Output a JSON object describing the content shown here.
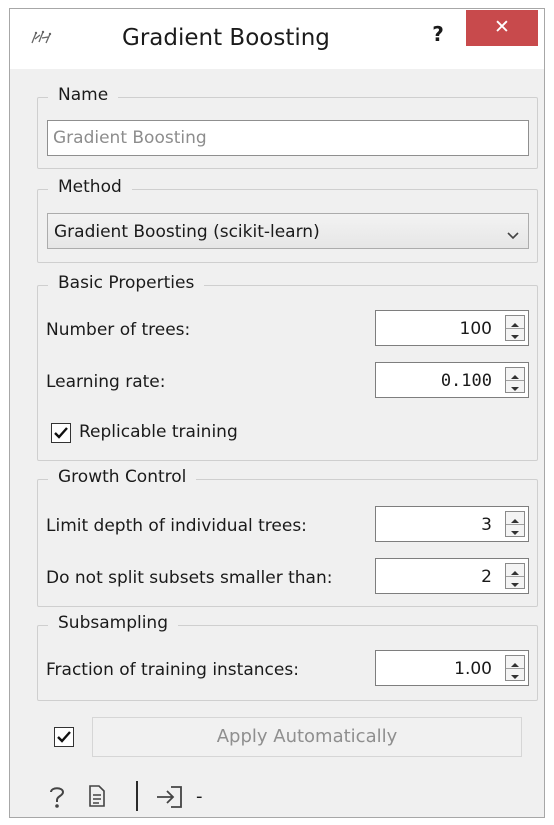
{
  "window": {
    "title": "Gradient Boosting",
    "help_glyph": "?",
    "close_glyph": "✕"
  },
  "name_group": {
    "legend": "Name",
    "value": "Gradient Boosting"
  },
  "method_group": {
    "legend": "Method",
    "selected": "Gradient Boosting (scikit-learn)"
  },
  "basic_properties": {
    "legend": "Basic Properties",
    "trees_label": "Number of trees:",
    "trees_value": "100",
    "learning_rate_label": "Learning rate:",
    "learning_rate_value": "0.100",
    "replicable_label": "Replicable training",
    "replicable_checked": true
  },
  "growth_control": {
    "legend": "Growth Control",
    "depth_label": "Limit depth of individual trees:",
    "depth_value": "3",
    "min_split_label": "Do not split subsets smaller than:",
    "min_split_value": "2"
  },
  "subsampling": {
    "legend": "Subsampling",
    "fraction_label": "Fraction of training instances:",
    "fraction_value": "1.00"
  },
  "footer": {
    "auto_apply_checked": true,
    "apply_label": "Apply Automatically",
    "dash": "-",
    "icons": [
      "help-icon",
      "report-icon",
      "input-icon"
    ]
  }
}
